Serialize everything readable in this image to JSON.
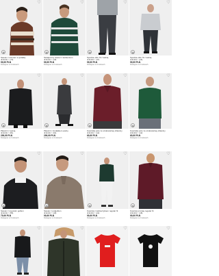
{
  "products": [
    {
      "title": "Sweter z wzorem w jodełkę",
      "rating": "★★★★☆",
      "reviews": "(73)",
      "price": "99,99 PLN",
      "note": "Dostępne w 3 kolorach"
    },
    {
      "title": "Świąteczny sweter z kołnierzem",
      "rating": "★★★★☆",
      "reviews": "(19)",
      "price": "99,99 PLN",
      "note": "Dostępne w 2 kolorach"
    },
    {
      "title": "Spodnie slim fit z wełną",
      "rating": "★★★★☆",
      "reviews": "(37)",
      "price": "99,99 PLN",
      "note": "Dostępne w 3 kolorach"
    },
    {
      "title": "Spodnie slim fit z wełną",
      "rating": "★★★★☆",
      "reviews": "(26)",
      "price": "99,99 PLN",
      "note": "Dostępne w 2 kolorach"
    },
    {
      "title": "Płaszcz z wełną",
      "rating": "★★★★☆",
      "reviews": "(81)",
      "price": "299,99 PLN",
      "note": "Dostępne w 2 kolorach"
    },
    {
      "title": "Płaszcz z dodatkiem wełny",
      "rating": "★★★★☆",
      "reviews": "(64)",
      "price": "299,99 PLN",
      "note": "Dostępne w 3 kolorach"
    },
    {
      "title": "Koszulka polo ze strukturalnej dzianiny",
      "rating": "★★★★☆",
      "reviews": "(12)",
      "price": "69,99 PLN",
      "note": "Dostępne w 4 kolorach"
    },
    {
      "title": "Koszulka polo ze strukturalnej dzianiny",
      "rating": "★★★★☆",
      "reviews": "(12)",
      "price": "69,99 PLN",
      "note": "Dostępne w 4 kolorach"
    },
    {
      "title": "Sweter z wysokim golfem",
      "rating": "★★★★☆",
      "reviews": "(55)",
      "price": "79,99 PLN",
      "note": "Dostępne w 5 kolorach"
    },
    {
      "title": "Sweter z półgolfem",
      "rating": "★★★★☆",
      "reviews": "(40)",
      "price": "99,99 PLN",
      "note": "Dostępne w 3 kolorach"
    },
    {
      "title": "Koszula z kołnierzykiem regular fit",
      "rating": "★★★★☆",
      "reviews": "(22)",
      "price": "99,99 PLN",
      "note": "Dostępne w 3 kolorach"
    },
    {
      "title": "Koszula w kratę regular fit",
      "rating": "★★★★☆",
      "reviews": "(18)",
      "price": "99,99 PLN",
      "note": "Dostępne w 2 kolorach"
    },
    {
      "title": "",
      "rating": "",
      "reviews": "",
      "price": "",
      "note": ""
    },
    {
      "title": "",
      "rating": "",
      "reviews": "",
      "price": "",
      "note": ""
    },
    {
      "title": "",
      "rating": "",
      "reviews": "",
      "price": "",
      "note": ""
    },
    {
      "title": "",
      "rating": "",
      "reviews": "",
      "price": "",
      "note": ""
    }
  ],
  "icons": {
    "favorite": "heart-outline-icon",
    "add_to_cart": "shopping-bag-icon"
  }
}
